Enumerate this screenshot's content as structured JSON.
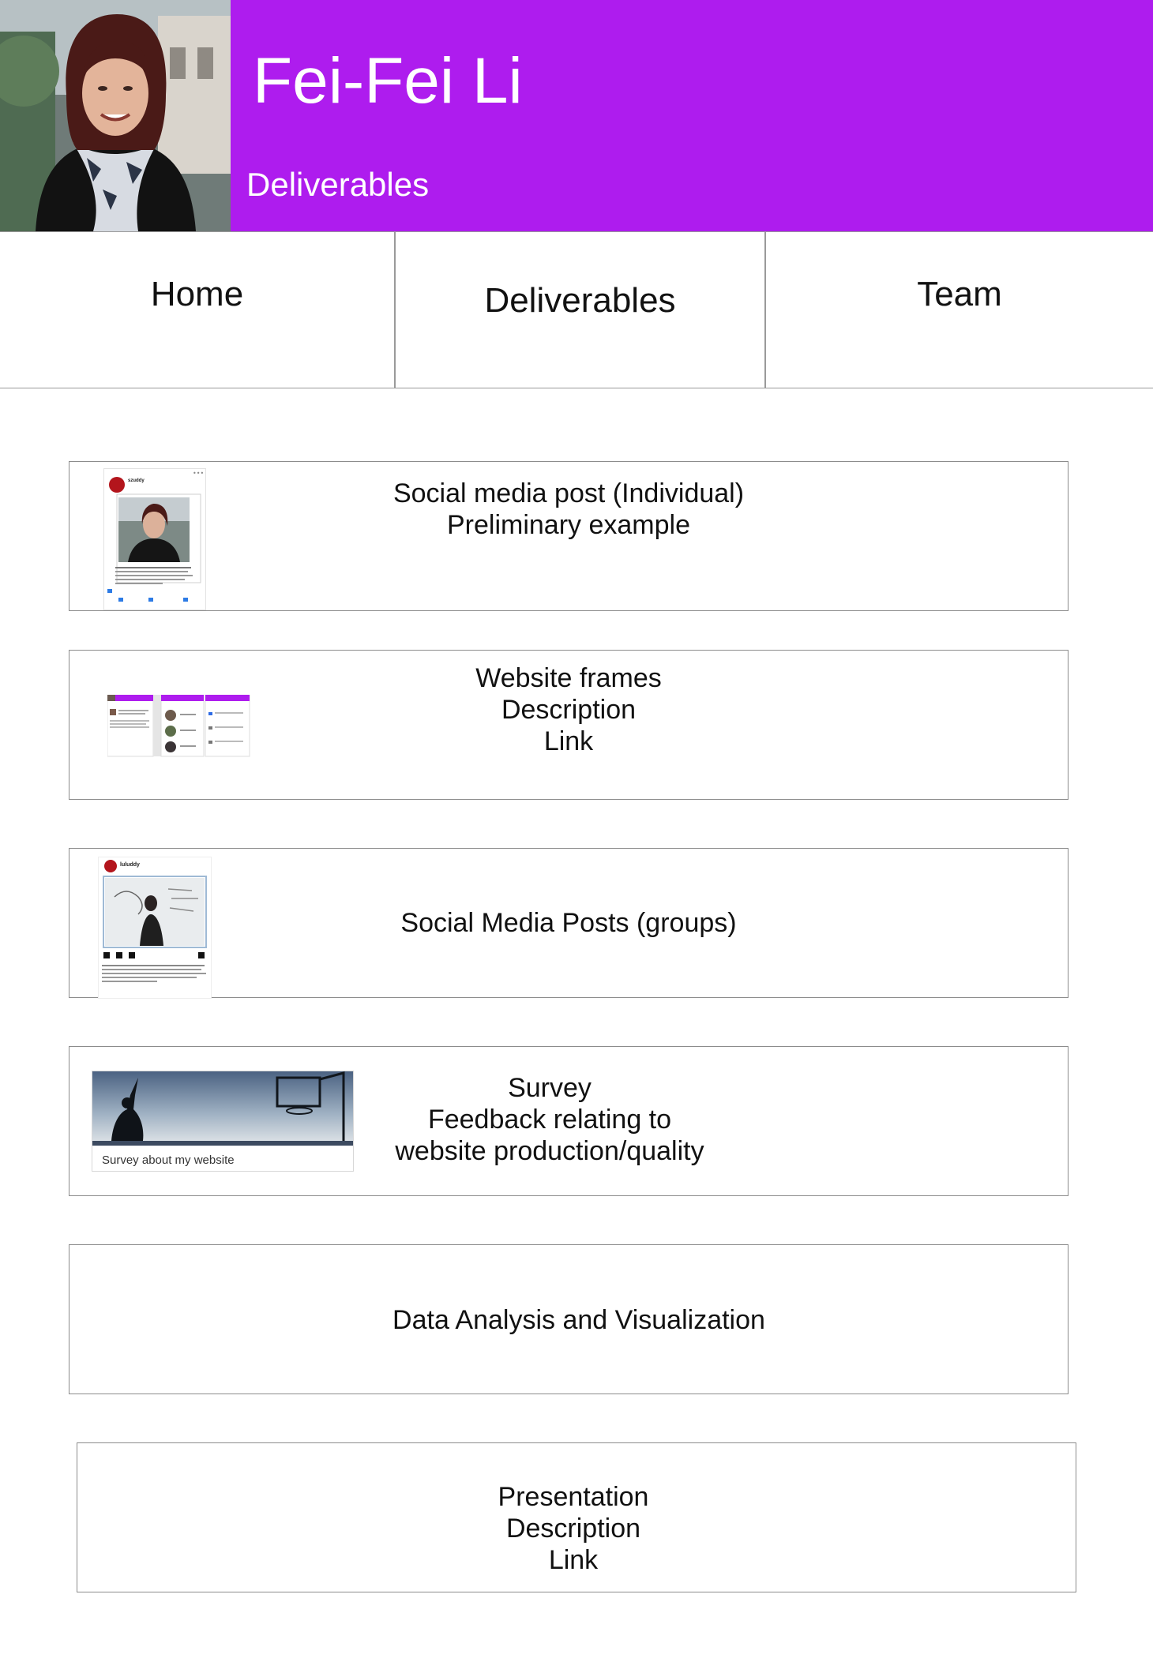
{
  "header": {
    "name": "Fei-Fei Li",
    "section": "Deliverables",
    "banner_color": "#ae1cee"
  },
  "nav": {
    "home": "Home",
    "deliverables": "Deliverables",
    "team": "Team"
  },
  "cards": [
    {
      "lines": [
        "Social media post (Individual)",
        "Preliminary example"
      ],
      "thumb_username": "szuddy"
    },
    {
      "lines": [
        "Website frames",
        "Description",
        "Link"
      ]
    },
    {
      "lines": [
        "Social Media Posts (groups)"
      ],
      "thumb_username": "luluddy"
    },
    {
      "lines": [
        "Survey",
        "Feedback relating to",
        "website production/quality"
      ],
      "thumb_caption": "Survey about my website"
    },
    {
      "lines": [
        "Data Analysis and Visualization"
      ]
    },
    {
      "lines": [
        "Presentation",
        "Description",
        "Link"
      ]
    }
  ]
}
